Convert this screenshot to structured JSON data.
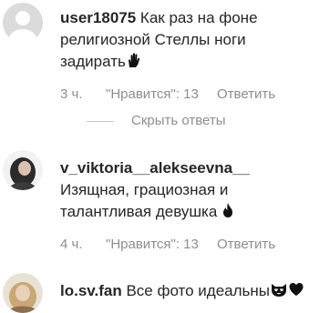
{
  "comments": [
    {
      "username": "user18075",
      "avatar_icon": "default-avatar-icon",
      "lines": [
        "Как раз на фоне",
        "религиозной Стеллы ноги",
        "задирать"
      ],
      "trailing_emoji": "raised-hand-icon",
      "time": "3 ч.",
      "likes": "\"Нравится\": 13",
      "reply": "Ответить",
      "hide_replies": "Скрыть ответы"
    },
    {
      "username": "v_viktoria__alekseevna__",
      "avatar_icon": "profile-photo-avatar",
      "lines": [
        "Изящная, грациозная и",
        "талантливая девушка"
      ],
      "trailing_emoji": "fire-icon",
      "time": "4 ч.",
      "likes": "\"Нравится\": 13",
      "reply": "Ответить"
    },
    {
      "username": "lo.sv.fan",
      "avatar_icon": "profile-photo-avatar",
      "lines": [
        "Все фото идеальны"
      ],
      "trailing_emoji": "heart-eyes-cat-and-black-heart-icons"
    }
  ]
}
